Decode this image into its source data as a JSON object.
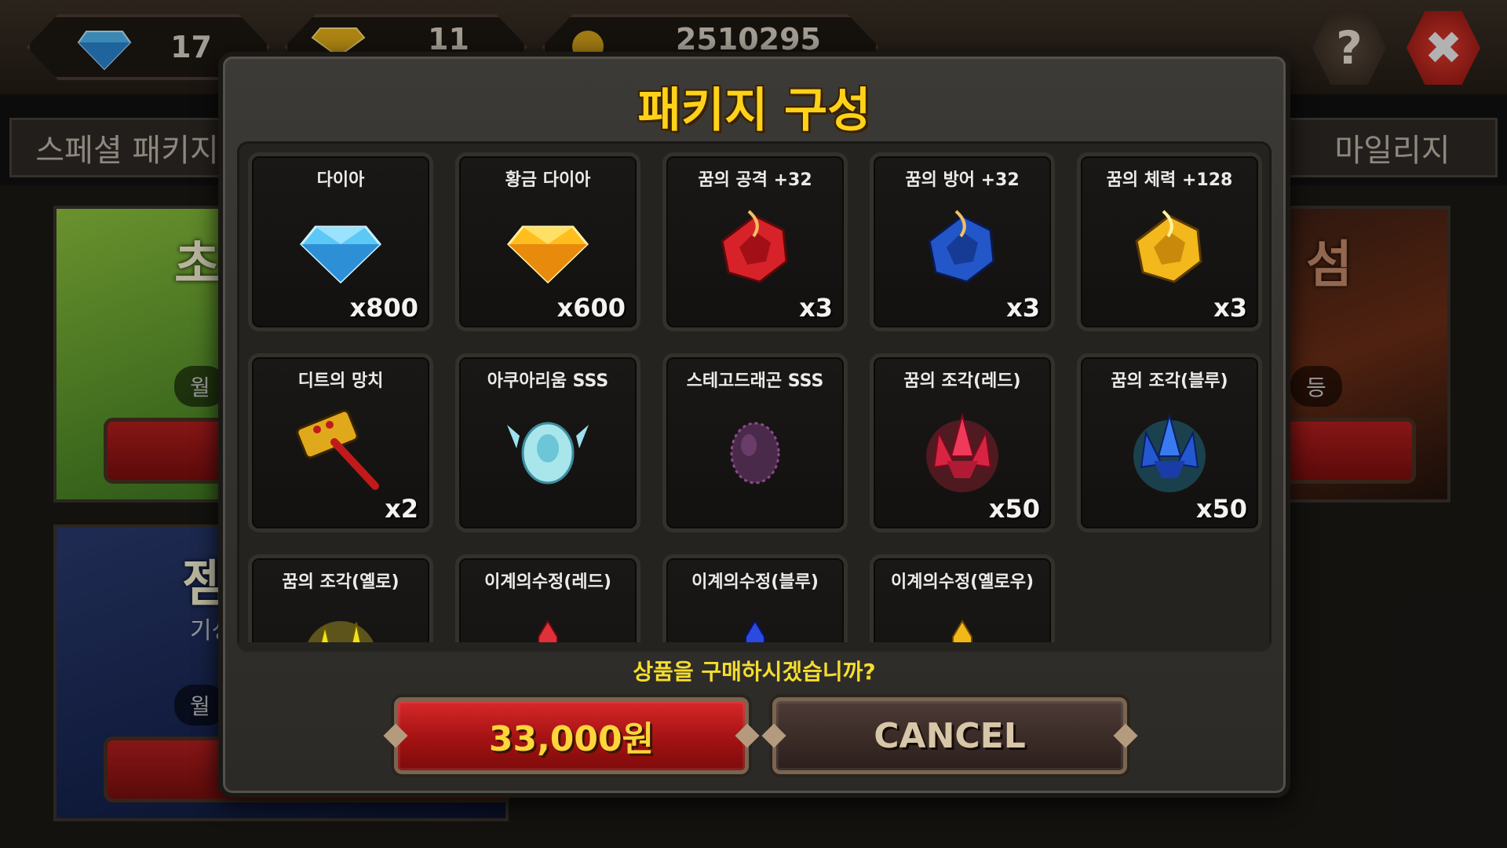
{
  "currency": {
    "gem_value": "17",
    "gold_gem_value": "11",
    "coin_value": "2510295"
  },
  "header": {
    "help_label": "?",
    "close_label": "✖"
  },
  "tabs": {
    "left_label": "스페셜 패키지",
    "right_label": "마일리지"
  },
  "background_cards": {
    "card_a_text": "초월",
    "card_a_sub": "월",
    "card_b_text": "젬",
    "card_b_sub": "월",
    "card_b_sub2": "기성",
    "card_c_text": "섬",
    "card_c_sub": "등"
  },
  "modal": {
    "title": "패키지 구성",
    "prompt": "상품을 구매하시겠습니까?",
    "buy_label": "33,000원",
    "cancel_label": "CANCEL",
    "items": [
      {
        "name": "다이아",
        "qty": "x800",
        "icon": "blue-diamond-icon"
      },
      {
        "name": "황금 다이아",
        "qty": "x600",
        "icon": "gold-diamond-icon"
      },
      {
        "name": "꿈의 공격 +32",
        "qty": "x3",
        "icon": "red-rune-stone-icon"
      },
      {
        "name": "꿈의 방어 +32",
        "qty": "x3",
        "icon": "blue-rune-stone-icon"
      },
      {
        "name": "꿈의 체력 +128",
        "qty": "x3",
        "icon": "yellow-rune-stone-icon"
      },
      {
        "name": "디트의 망치",
        "qty": "x2",
        "icon": "hammer-icon"
      },
      {
        "name": "아쿠아리움 SSS",
        "qty": "",
        "icon": "aqua-egg-icon"
      },
      {
        "name": "스테고드래곤 SSS",
        "qty": "",
        "icon": "purple-egg-icon"
      },
      {
        "name": "꿈의 조각(레드)",
        "qty": "x50",
        "icon": "red-crystal-cluster-icon"
      },
      {
        "name": "꿈의 조각(블루)",
        "qty": "x50",
        "icon": "blue-crystal-cluster-icon"
      },
      {
        "name": "꿈의 조각(옐로)",
        "qty": "",
        "icon": "yellow-crystal-cluster-icon"
      },
      {
        "name": "이계의수정(레드)",
        "qty": "",
        "icon": "red-crystal-shard-icon"
      },
      {
        "name": "이계의수정(블루)",
        "qty": "",
        "icon": "blue-crystal-shard-icon"
      },
      {
        "name": "이계의수정(옐로우)",
        "qty": "",
        "icon": "yellow-crystal-shard-icon"
      }
    ]
  },
  "colors": {
    "title_gold": "#ffd21a",
    "prompt_yellow": "#f5dd2e",
    "buy_red": "#c41a1c",
    "cancel_brown": "#3a2b27"
  }
}
